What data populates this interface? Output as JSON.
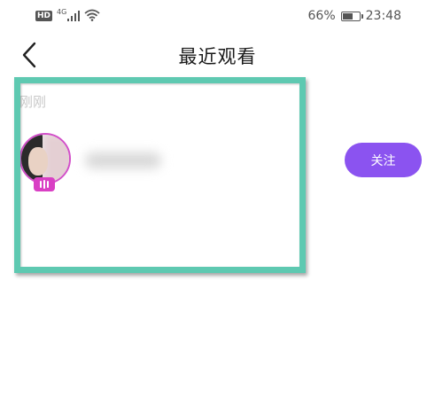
{
  "status_bar": {
    "hd_label": "HD",
    "network_type": "4G",
    "battery_percent": "66%",
    "battery_level": 0.66,
    "time": "23:48",
    "icons": [
      "signal-icon",
      "wifi-icon",
      "battery-icon"
    ]
  },
  "header": {
    "title": "最近观看",
    "back_icon": "chevron-left-icon"
  },
  "content": {
    "section_label": "刚刚",
    "user": {
      "avatar_ring_color": "#d24fc9",
      "live_badge_color": "#d93fc4"
    },
    "follow_label": "关注",
    "follow_color": "#8b53f0"
  },
  "highlight_color": "#5ec9b1"
}
